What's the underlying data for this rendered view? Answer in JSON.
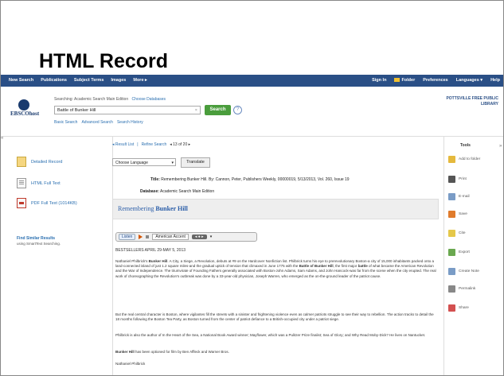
{
  "slide_title": "HTML Record",
  "topbar": {
    "left": [
      "New Search",
      "Publications",
      "Subject Terms",
      "Images",
      "More ▸"
    ],
    "right": [
      "Sign In",
      "Folder",
      "Preferences",
      "Languages ▾",
      "Help"
    ]
  },
  "header": {
    "logo_text": "EBSCOhost",
    "searching_label": "Searching:",
    "database": "Academic Search Main Edition",
    "choose_db": "Choose Databases",
    "search_value": "Battle of Bunker Hill",
    "search_button": "Search",
    "links": [
      "Basic Search",
      "Advanced Search",
      "Search History"
    ],
    "library_line1": "POTTSVILLE FREE PUBLIC",
    "library_line2": "LIBRARY"
  },
  "left_pane": {
    "items": [
      "Detailed Record",
      "HTML Full Text",
      "PDF Full Text (1014KB)"
    ],
    "find_similar": "Find Similar Results",
    "find_similar_sub": "using SmartText Searching."
  },
  "main": {
    "nav": [
      "◂ Result List",
      "Refine Search",
      "◂ 13 of 20 ▸"
    ],
    "language_select": "Choose Language",
    "translate_button": "Translate",
    "title_label": "Title:",
    "title_value": "Remembering Bunker Hill. By: Cannon, Peter, Publishers Weekly, 00000019, 5/13/2013, Vol. 260, Issue 19",
    "database_label": "Database:",
    "database_value": "Academic Search Main Edition",
    "article_title_plain": "Remembering",
    "article_title_bold": "Bunker Hill",
    "audio": {
      "listen": "Listen",
      "voice": "American Accent"
    },
    "bestsellers": "BESTSELLERS APRIL 29-MAY 5, 2013",
    "p1_a": "Nathaniel Philbrick's",
    "p1_b": "Bunker Hill",
    "p1_c": ". A City, a Siege, a Revolution, debuts at #9 on the Hardcover Nonfiction list. Philbrick turns his eye to prerevolutionary Boston-a city of 15,000 inhabitants packed onto a land-connected island of just 1.2 square miles-and the gradual uptick of tension that climaxed in June 1775 with the",
    "p1_d": "Battle of Bunker Hill",
    "p1_e": ", the first major",
    "p1_f": "battle",
    "p1_g": "of what became the American Revolution and the War of Independence. The triumvirate of Founding Fathers generally associated with Boston-John Adams, Sam Adams, and John Hancock-was far from the scene when the city erupted. The real work of choreographing the Revolution's outbreak was done by a 33-year-old physician, Joseph Warren, who emerged as the on-the-ground leader of the patriot cause.",
    "p2": "But the real central character is Boston, where vigilantes fill the streets with a sinister and frightening violence even as calmer patriots struggle to see their way to rebellion. The action tracks to detail the 18 months following the Boston Tea Party, as Boston turned from the center of patriot defiance to a British-occupied city under a patriot siege.",
    "p3": "Philbrick is also the author of In the Heart of the Sea, a National Book Award winner; Mayflower, which was a Pulitzer Prize finalist; Sea of Glory; and Why Read Moby-Dick? He lives on Nantucket.",
    "p4_a": "Bunker Hill",
    "p4_b": "has been optioned for film by Ben Affleck and Warner Bros.",
    "p5": "Nathaniel Philbrick"
  },
  "tools": {
    "title": "Tools",
    "items": [
      "Add to folder",
      "Print",
      "E-mail",
      "Save",
      "Cite",
      "Export",
      "Create Note",
      "Permalink",
      "Share"
    ],
    "colors": [
      "#e5b93d",
      "#555555",
      "#7a9cc6",
      "#e07b2c",
      "#e5c84a",
      "#6aa84f",
      "#7a9cc6",
      "#888888",
      "#d35050"
    ]
  }
}
